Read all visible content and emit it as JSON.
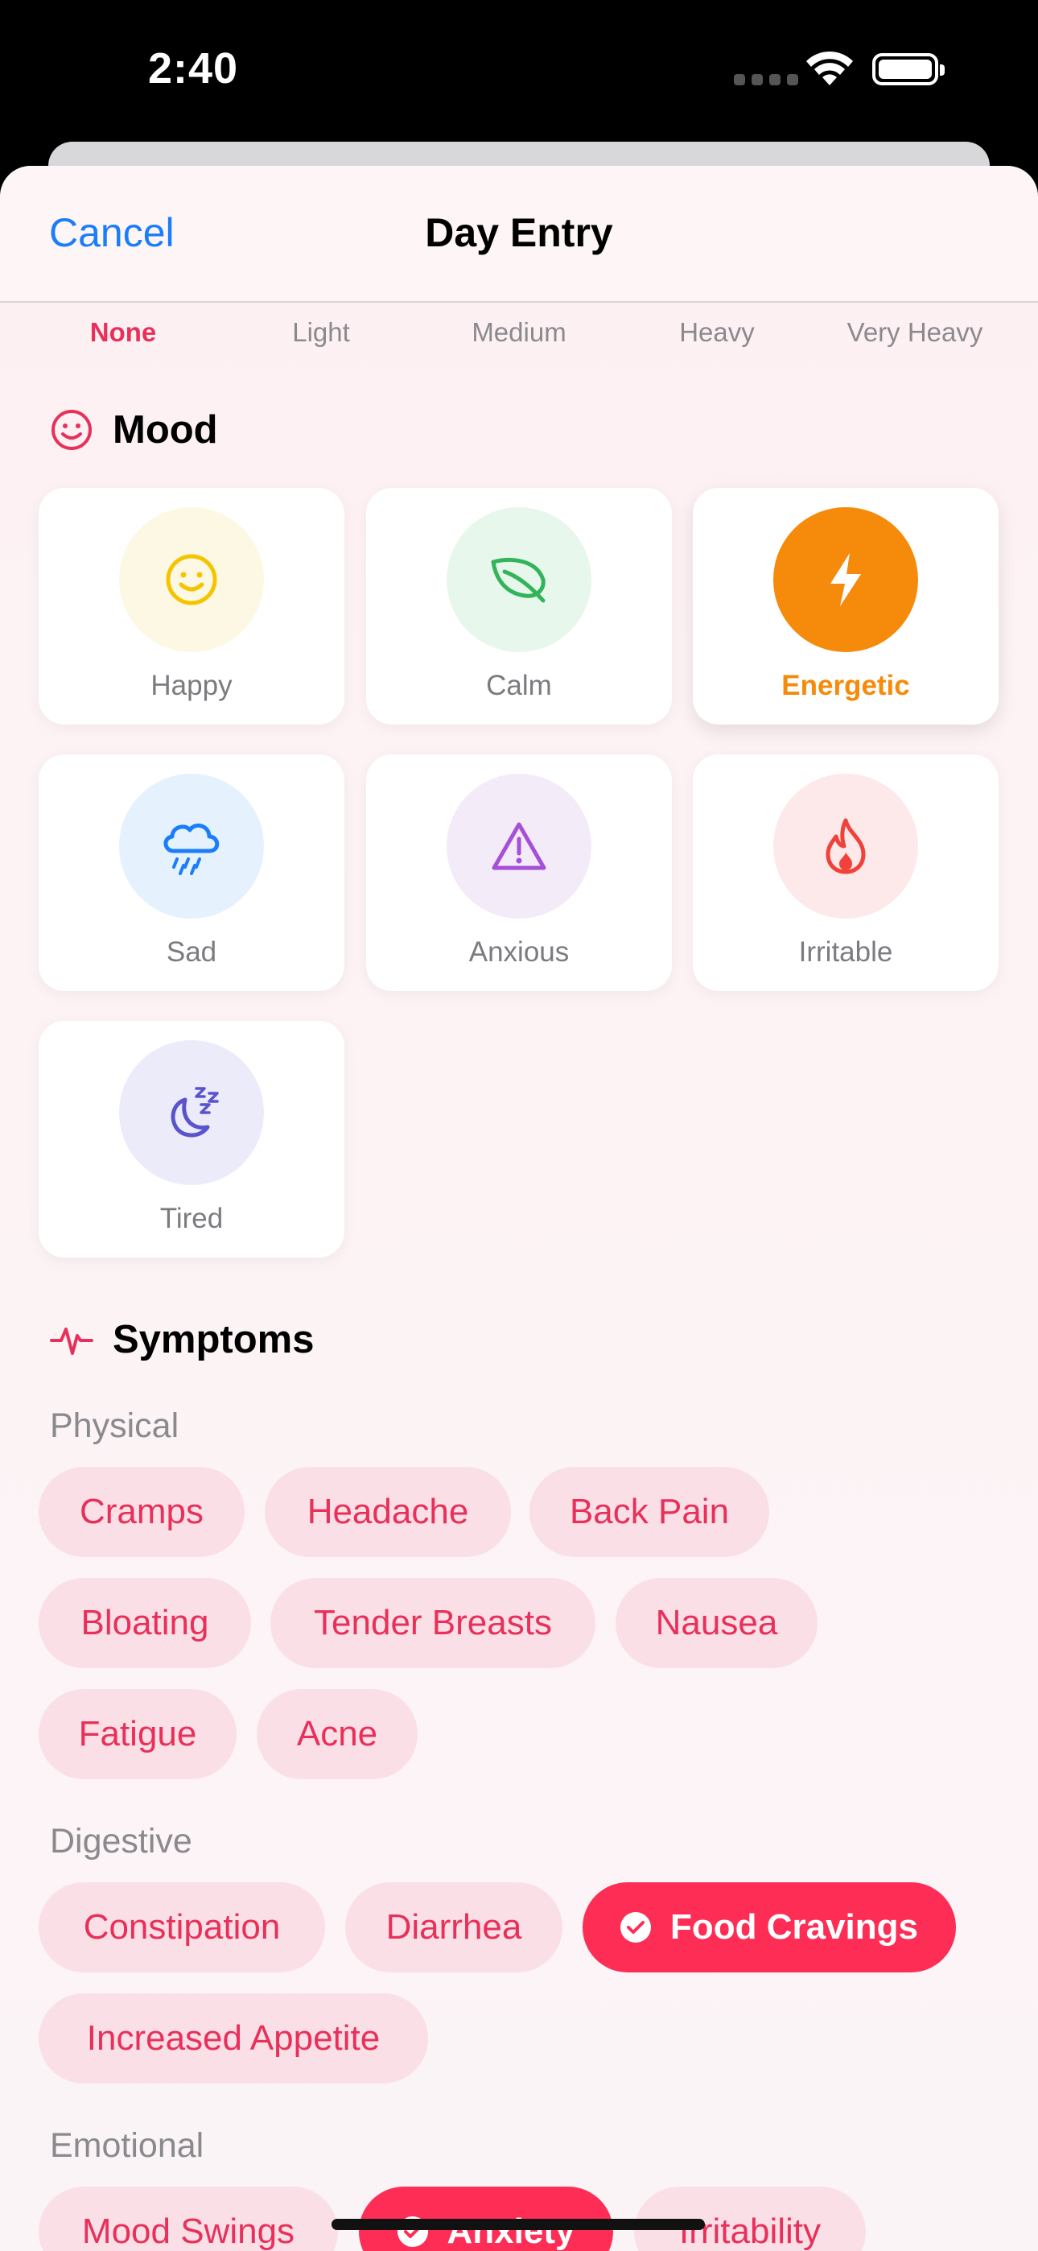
{
  "status_bar": {
    "time": "2:40"
  },
  "nav": {
    "cancel_label": "Cancel",
    "title": "Day Entry"
  },
  "flow": {
    "options": [
      "None",
      "Light",
      "Medium",
      "Heavy",
      "Very Heavy"
    ],
    "selected": "None"
  },
  "mood": {
    "section_title": "Mood",
    "items": [
      {
        "label": "Happy",
        "icon": "smiley-icon",
        "color": "#f5c400",
        "bg": "#fdf8e3",
        "selected": false
      },
      {
        "label": "Calm",
        "icon": "leaf-icon",
        "color": "#32b45a",
        "bg": "#e8f7ec",
        "selected": false
      },
      {
        "label": "Energetic",
        "icon": "lightning-bolt-icon",
        "color": "#f68a0a",
        "bg": "#f68a0a",
        "selected": true
      },
      {
        "label": "Sad",
        "icon": "cloud-rain-icon",
        "color": "#1a7dfa",
        "bg": "#e6f1fe",
        "selected": false
      },
      {
        "label": "Anxious",
        "icon": "warning-triangle-icon",
        "color": "#a650d6",
        "bg": "#f3ebf8",
        "selected": false
      },
      {
        "label": "Irritable",
        "icon": "flame-icon",
        "color": "#f0423a",
        "bg": "#fde9e9",
        "selected": false
      },
      {
        "label": "Tired",
        "icon": "moon-zzz-icon",
        "color": "#5a54cc",
        "bg": "#ecebf9",
        "selected": false
      }
    ]
  },
  "symptoms": {
    "section_title": "Symptoms",
    "groups": [
      {
        "label": "Physical",
        "chips": [
          {
            "label": "Cramps",
            "selected": false
          },
          {
            "label": "Headache",
            "selected": false
          },
          {
            "label": "Back Pain",
            "selected": false
          },
          {
            "label": "Bloating",
            "selected": false
          },
          {
            "label": "Tender Breasts",
            "selected": false
          },
          {
            "label": "Nausea",
            "selected": false
          },
          {
            "label": "Fatigue",
            "selected": false
          },
          {
            "label": "Acne",
            "selected": false
          }
        ]
      },
      {
        "label": "Digestive",
        "chips": [
          {
            "label": "Constipation",
            "selected": false
          },
          {
            "label": "Diarrhea",
            "selected": false
          },
          {
            "label": "Food Cravings",
            "selected": true
          },
          {
            "label": "Increased Appetite",
            "selected": false
          }
        ]
      },
      {
        "label": "Emotional",
        "chips": [
          {
            "label": "Mood Swings",
            "selected": false
          },
          {
            "label": "Anxiety",
            "selected": true
          },
          {
            "label": "Irritability",
            "selected": false
          }
        ]
      }
    ]
  },
  "colors": {
    "accent": "#e8305a",
    "selected_chip": "#fd2d55",
    "chip_bg": "#fae0e6",
    "link": "#1a7dfa"
  }
}
